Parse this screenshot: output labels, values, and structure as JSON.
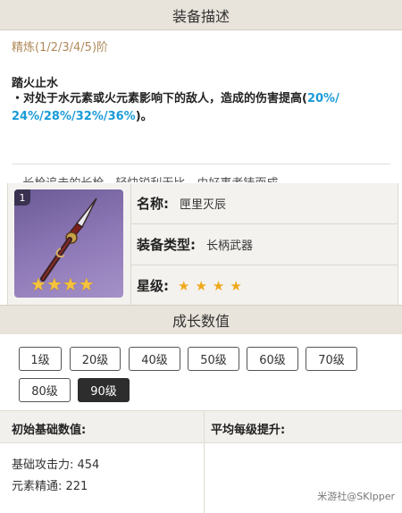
{
  "header": {
    "title": "装备描述"
  },
  "description": {
    "refine_label": "精炼(1/2/3/4/5)阶",
    "passive_title": "踏火止水",
    "passive_prefix": "・对处于水元素或火元素影响下的敌人，造成的伤害提高(",
    "passive_values_line1": "20%/",
    "passive_values_line2": "24%/28%/32%/36%",
    "passive_suffix": ")。",
    "cut_text": "...长枪追击的长枪，轻快锐利无比，由好事者铸而成..."
  },
  "weapon": {
    "badge": "1",
    "portrait_stars": "★★★★",
    "name_key": "名称:",
    "name_value": "匣里灭辰",
    "type_key": "装备类型:",
    "type_value": "长柄武器",
    "rarity_key": "星级:",
    "rarity_value": 4,
    "rarity_stars": "★★★★"
  },
  "growth": {
    "title": "成长数值",
    "levels": [
      "1级",
      "20级",
      "40级",
      "50级",
      "60级",
      "70级",
      "80级",
      "90级"
    ],
    "selected": "90级"
  },
  "stats": {
    "col1_header": "初始基础数值:",
    "col2_header": "平均每级提升:",
    "base_atk": "基础攻击力: 454",
    "elemental_mastery": "元素精通: 221"
  },
  "watermark": "米游社@SKIpper",
  "colors": {
    "header_bg": "#e8e3db",
    "highlight_blue": "#1a9bd7",
    "refine_text": "#b08a5a",
    "star_gold": "#f0a81a",
    "selected_level_bg": "#2d2d2d"
  }
}
